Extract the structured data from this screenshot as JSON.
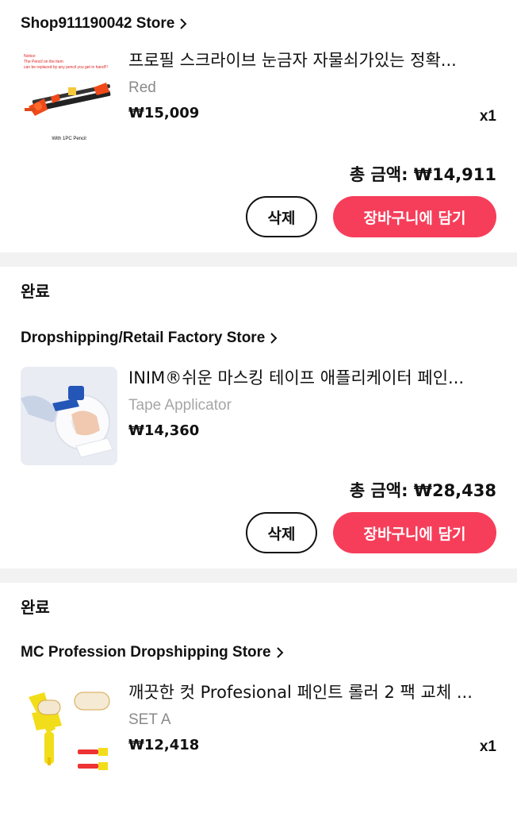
{
  "orders": [
    {
      "store": "Shop911190042 Store",
      "item": {
        "title": "프로필 스크라이브 눈금자 자물쇠가있는 정확...",
        "variant": "Red",
        "price": "₩15,009",
        "qty": "x1",
        "thumb_text_top": "Notice:",
        "thumb_text_line2": "The Pencil on the item",
        "thumb_text_line3": "can be replaced by any pencil you get in hand!!!",
        "thumb_caption": "With 1PC Pencil"
      },
      "total": "총 금액: ₩14,911",
      "delete_label": "삭제",
      "cart_label": "장바구니에 담기"
    },
    {
      "status": "완료",
      "store": "Dropshipping/Retail Factory Store",
      "item": {
        "title": "INIM®쉬운 마스킹 테이프 애플리케이터 페인...",
        "variant": "Tape Applicator",
        "price": "₩14,360"
      },
      "total": "총 금액: ₩28,438",
      "delete_label": "삭제",
      "cart_label": "장바구니에 담기"
    },
    {
      "status": "완료",
      "store": "MC Profession Dropshipping Store",
      "item": {
        "title": "깨끗한 컷 Profesional 페인트 롤러 2 팩 교체 ...",
        "variant": "SET A",
        "price": "₩12,418",
        "qty": "x1"
      }
    }
  ],
  "colors": {
    "accent": "#f63e5a",
    "divider": "#f2f2f2",
    "muted": "#8a8a8a"
  }
}
